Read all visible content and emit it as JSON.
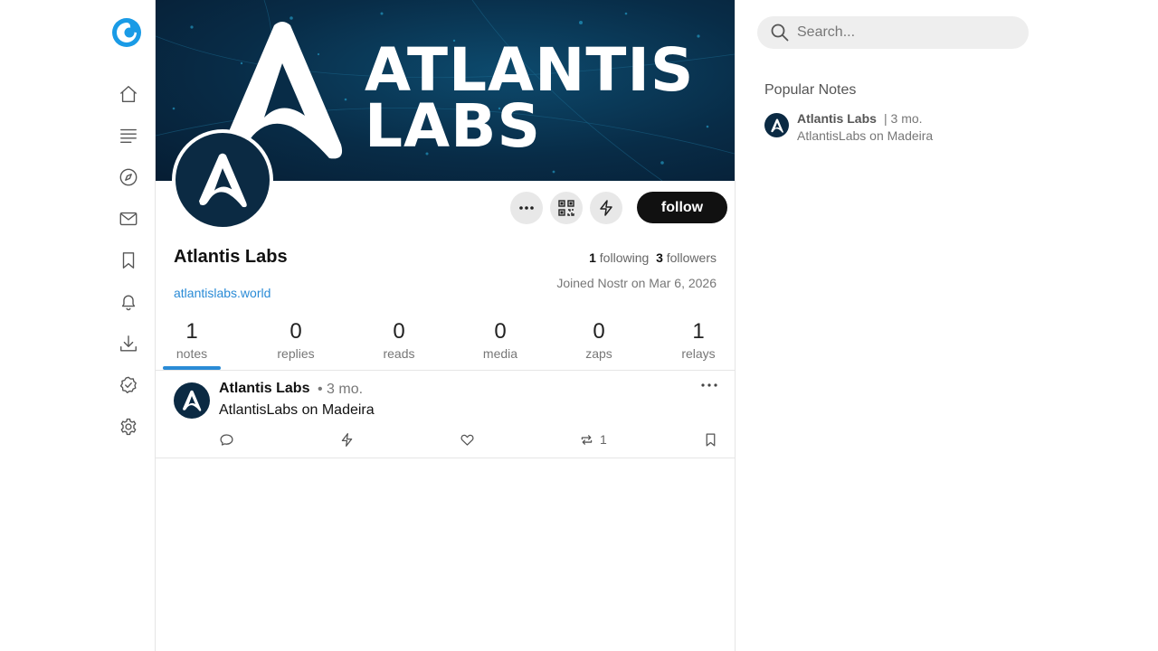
{
  "nav": {
    "items": [
      {
        "name": "home",
        "icon": "home-icon"
      },
      {
        "name": "feed",
        "icon": "list-icon"
      },
      {
        "name": "explore",
        "icon": "compass-icon"
      },
      {
        "name": "messages",
        "icon": "mail-icon"
      },
      {
        "name": "bookmarks",
        "icon": "bookmark-icon"
      },
      {
        "name": "notifications",
        "icon": "bell-icon"
      },
      {
        "name": "downloads",
        "icon": "download-icon"
      },
      {
        "name": "verification",
        "icon": "badge-check-icon"
      },
      {
        "name": "settings",
        "icon": "gear-icon"
      }
    ]
  },
  "profile": {
    "banner_line1": "ATLANTIS",
    "banner_line2": "LABS",
    "name": "Atlantis Labs",
    "website": "atlantislabs.world",
    "following_count": "1",
    "following_label": "following",
    "followers_count": "3",
    "followers_label": "followers",
    "joined": "Joined Nostr on Mar 6, 2026",
    "follow_label": "follow"
  },
  "tabs": [
    {
      "count": "1",
      "label": "notes"
    },
    {
      "count": "0",
      "label": "replies"
    },
    {
      "count": "0",
      "label": "reads"
    },
    {
      "count": "0",
      "label": "media"
    },
    {
      "count": "0",
      "label": "zaps"
    },
    {
      "count": "1",
      "label": "relays"
    }
  ],
  "active_tab": "notes",
  "note": {
    "author": "Atlantis Labs",
    "time": "• 3 mo.",
    "content": "AtlantisLabs on Madeira",
    "reposts": "1"
  },
  "search": {
    "placeholder": "Search..."
  },
  "popular": {
    "title": "Popular Notes",
    "items": [
      {
        "author": "Atlantis Labs",
        "time": "| 3 mo.",
        "content": "AtlantisLabs on Madeira"
      }
    ]
  },
  "colors": {
    "accent": "#2a8bd6",
    "banner": "#082c47",
    "follow_bg": "#111111"
  }
}
